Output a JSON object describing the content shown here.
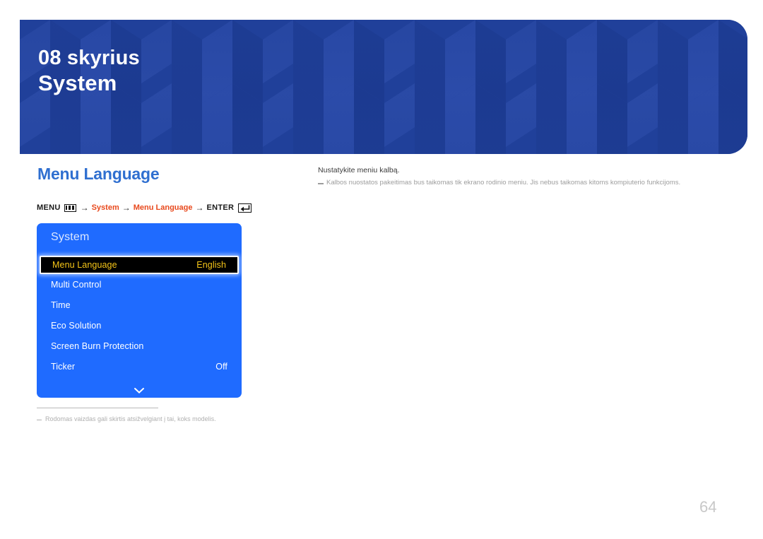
{
  "header": {
    "chapter": "08 skyrius",
    "title": "System",
    "background_color": "#20409a"
  },
  "section": {
    "heading": "Menu Language",
    "heading_color": "#2f6fd0"
  },
  "menu_path": {
    "menu_label": "MENU",
    "menu_icon": "menu-bars-icon",
    "arrow1": "→",
    "step1": "System",
    "arrow2": "→",
    "step2": "Menu Language",
    "arrow3": "→",
    "enter_label": "ENTER",
    "enter_icon": "enter-return-icon",
    "highlight_color": "#e8491d"
  },
  "osd": {
    "title": "System",
    "background_color": "#1f6bff",
    "selected_text_color": "#f5c518",
    "chevron_icon": "chevron-down-icon",
    "rows": [
      {
        "label": "Menu Language",
        "value": "English",
        "selected": true
      },
      {
        "label": "Multi Control",
        "value": "",
        "selected": false
      },
      {
        "label": "Time",
        "value": "",
        "selected": false
      },
      {
        "label": "Eco Solution",
        "value": "",
        "selected": false
      },
      {
        "label": "Screen Burn Protection",
        "value": "",
        "selected": false
      },
      {
        "label": "Ticker",
        "value": "Off",
        "selected": false
      }
    ]
  },
  "footnote": {
    "text": "Rodomas vaizdas gali skirtis atsižvelgiant į tai, koks modelis."
  },
  "description": {
    "main": "Nustatykite meniu kalbą.",
    "note": "Kalbos nuostatos pakeitimas bus taikomas tik ekrano rodinio meniu. Jis nebus taikomas kitoms kompiuterio funkcijoms."
  },
  "page": {
    "number": "64"
  }
}
